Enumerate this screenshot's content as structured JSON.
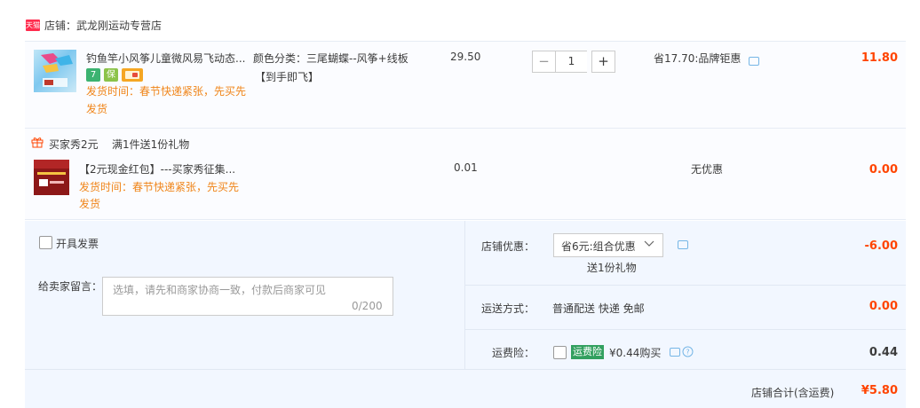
{
  "shop": {
    "badge": "天猫",
    "name": "店铺：武龙刚运动专营店"
  },
  "items": [
    {
      "title": "钓鱼竿小风筝儿童微风易飞动态...",
      "sku": "颜色分类：三尾蝴蝶--风筝+线板",
      "sku_extra": "【到手即飞】",
      "unit_price": "29.50",
      "quantity": "1",
      "discount": "省17.70:品牌钜惠",
      "subtotal": "11.80",
      "shipping_note_1": "发货时间：春节快递紧张，先买先",
      "shipping_note_2": "发货",
      "service_icons": [
        "seven-day-return-icon",
        "guarantee-icon",
        "card-icon"
      ],
      "service_icon_texts": [
        "7",
        "保",
        ""
      ]
    },
    {
      "title": "【2元现金红包】---买家秀征集...",
      "unit_price": "0.01",
      "discount": "无优惠",
      "subtotal": "0.00",
      "shipping_note_1": "发货时间：春节快递紧张，先买先",
      "shipping_note_2": "发货"
    }
  ],
  "gift": {
    "label": "买家秀2元",
    "rule": "满1件送1份礼物"
  },
  "invoice": {
    "label": "开具发票"
  },
  "message": {
    "label": "给卖家留言：",
    "placeholder": "选填，请先和商家协商一致，付款后商家可见",
    "counter": "0/200"
  },
  "shop_discount": {
    "label": "店铺优惠：",
    "selected": "省6元:组合优惠",
    "note": "送1份礼物",
    "value": "-6.00"
  },
  "shipping": {
    "label": "运送方式：",
    "method": "普通配送 快递 免邮",
    "value": "0.00"
  },
  "insurance": {
    "label": "运费险：",
    "badge": "运费险",
    "text": "¥0.44购买",
    "value": "0.44"
  },
  "total": {
    "label": "店铺合计(含运费)",
    "value": "¥5.80"
  },
  "colors": {
    "price_red": "#ff4400",
    "notice_orange": "#f08519",
    "accent_blue": "#76b6e6",
    "insurance_green": "#32a05f",
    "tmall_red": "#ff2b4d"
  }
}
